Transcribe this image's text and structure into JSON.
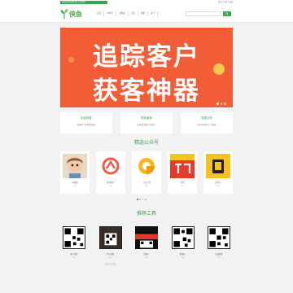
{
  "topbar": {
    "notice": "欢迎来到私域运营工具导航",
    "links": "登录 | 注册 | 投稿"
  },
  "header": {
    "logo_text": "侠鱼",
    "nav": [
      "首页",
      "公众号",
      "小程序",
      "工具",
      "资讯",
      "关于"
    ],
    "search_placeholder": ""
  },
  "banner": {
    "line1": "追踪客户",
    "line2": "获客神器",
    "slides": 3,
    "active_slide": 1
  },
  "features": [
    {
      "title": "免费获客",
      "desc": "海量客户资源免费使用"
    },
    {
      "title": "精准营销",
      "desc": "智能推送触达目标客户"
    },
    {
      "title": "数据分析",
      "desc": "实时追踪客户行为数据"
    }
  ],
  "sections": {
    "accounts_title": "精选公众号",
    "tools_title": "推荐工具"
  },
  "accounts": [
    {
      "name": "AI助理",
      "meta": "1.2k"
    },
    {
      "name": "获客助手",
      "meta": "980"
    },
    {
      "name": "小白工具",
      "meta": "860"
    },
    {
      "name": "开单",
      "meta": "750"
    },
    {
      "name": "任务宝",
      "meta": "640"
    }
  ],
  "tools": [
    {
      "name": "客户追踪",
      "meta": "300"
    },
    {
      "name": "今日获客",
      "meta": "280",
      "extra": "扫码关注获取"
    },
    {
      "name": "找客户",
      "meta": "260"
    },
    {
      "name": "推客宝",
      "meta": "240"
    },
    {
      "name": "私域管家",
      "meta": "220"
    }
  ],
  "colors": {
    "brand": "#3aa54f",
    "banner": "#f25c36"
  }
}
